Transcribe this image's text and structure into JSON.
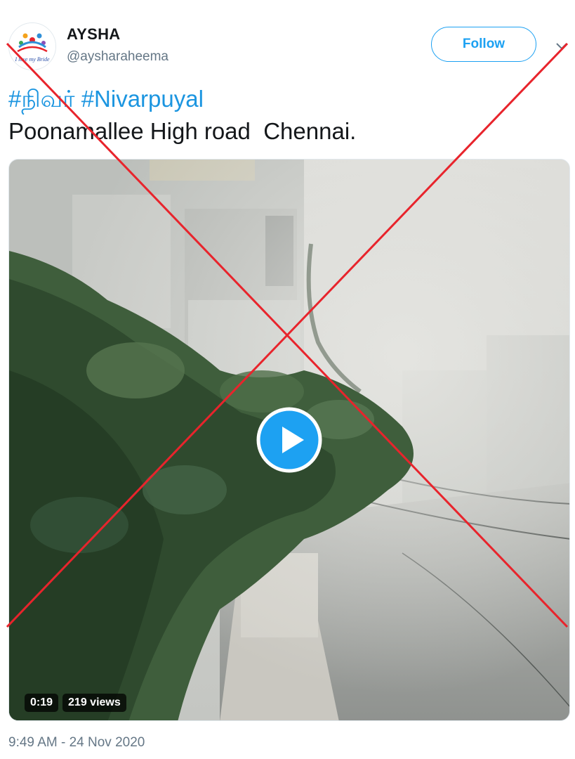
{
  "author": {
    "display_name": "AYSHA",
    "handle": "@aysharaheema",
    "avatar_text": "I love my Bride"
  },
  "follow_label": "Follow",
  "tweet": {
    "hashtag_1": "#நிவர்",
    "hashtag_2": "#Nivarpuyal",
    "text": "Poonamallee High road  Chennai."
  },
  "video": {
    "duration": "0:19",
    "views": "219 views"
  },
  "timestamp": "9:49 AM - 24 Nov 2020",
  "colors": {
    "accent": "#1da1f2",
    "hashtag": "#1b95e0",
    "cross": "#e8242c"
  }
}
